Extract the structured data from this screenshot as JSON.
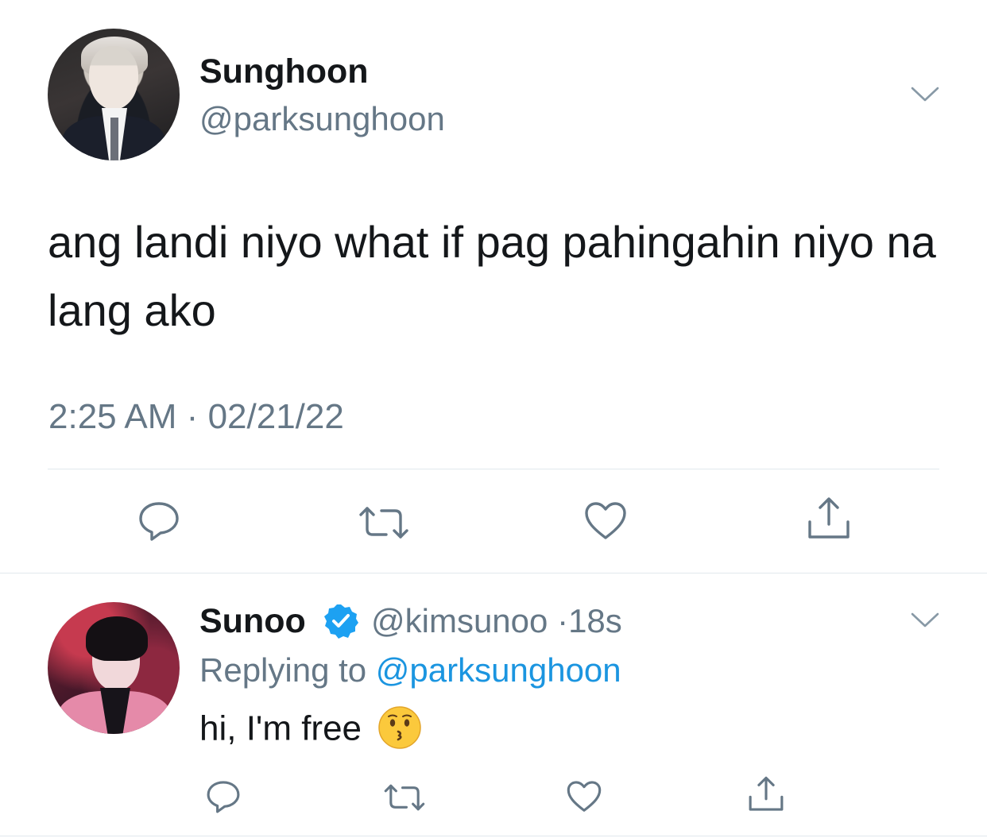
{
  "tweet": {
    "author_name": "Sunghoon",
    "author_handle": "@parksunghoon",
    "text": "ang landi niyo what if pag pahingahin niyo na lang ako",
    "time": "2:25 AM",
    "separator": "·",
    "date": "02/21/22",
    "actions": [
      "reply-icon",
      "retweet-icon",
      "like-icon",
      "share-icon"
    ]
  },
  "reply": {
    "author_name": "Sunoo",
    "verified": true,
    "author_handle": "@kimsunoo",
    "separator": "·",
    "age": "18s",
    "replying_prefix": "Replying to",
    "replying_mention": "@parksunghoon",
    "text": "hi, I'm free",
    "emoji": "kissing-face-emoji",
    "actions": [
      "reply-icon",
      "retweet-icon",
      "like-icon",
      "share-icon"
    ]
  },
  "colors": {
    "text": "#14171a",
    "secondary": "#657786",
    "link": "#1b95e0",
    "divider": "#e1e8ed",
    "verified": "#1da1f2"
  }
}
